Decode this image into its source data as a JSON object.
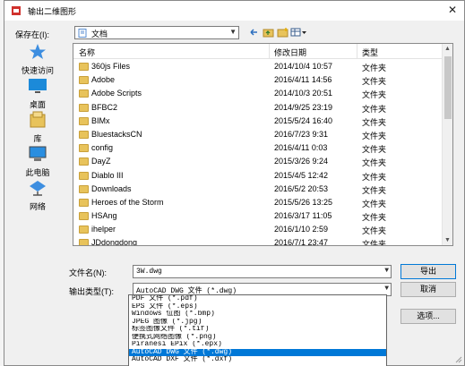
{
  "dialog": {
    "title": "输出二维图形",
    "close_glyph": "✕"
  },
  "location": {
    "label": "保存在(I):",
    "current_folder": "文档"
  },
  "toolbar": {
    "back": "back-arrow",
    "up": "up-folder",
    "new_folder": "new-folder",
    "views": "view-menu"
  },
  "places": [
    {
      "label": "快速访问",
      "icon": "star-icon"
    },
    {
      "label": "桌面",
      "icon": "desktop-icon"
    },
    {
      "label": "库",
      "icon": "library-icon"
    },
    {
      "label": "此电脑",
      "icon": "computer-icon"
    },
    {
      "label": "网络",
      "icon": "network-icon"
    }
  ],
  "file_list": {
    "columns": [
      "名称",
      "修改日期",
      "类型"
    ],
    "rows": [
      {
        "name": "360js Files",
        "date": "2014/10/4 10:57",
        "type": "文件夹"
      },
      {
        "name": "Adobe",
        "date": "2016/4/11 14:56",
        "type": "文件夹"
      },
      {
        "name": "Adobe Scripts",
        "date": "2014/10/3 20:51",
        "type": "文件夹"
      },
      {
        "name": "BFBC2",
        "date": "2014/9/25 23:19",
        "type": "文件夹"
      },
      {
        "name": "BIMx",
        "date": "2015/5/24 16:40",
        "type": "文件夹"
      },
      {
        "name": "BluestacksCN",
        "date": "2016/7/23 9:31",
        "type": "文件夹"
      },
      {
        "name": "config",
        "date": "2016/4/11 0:03",
        "type": "文件夹"
      },
      {
        "name": "DayZ",
        "date": "2015/3/26 9:24",
        "type": "文件夹"
      },
      {
        "name": "Diablo III",
        "date": "2015/4/5 12:42",
        "type": "文件夹"
      },
      {
        "name": "Downloads",
        "date": "2016/5/2 20:53",
        "type": "文件夹"
      },
      {
        "name": "Heroes of the Storm",
        "date": "2015/5/26 13:25",
        "type": "文件夹"
      },
      {
        "name": "HSAng",
        "date": "2016/3/17 11:05",
        "type": "文件夹"
      },
      {
        "name": "ihelper",
        "date": "2016/1/10 2:59",
        "type": "文件夹"
      },
      {
        "name": "JDdongdong",
        "date": "2016/7/1 23:47",
        "type": "文件夹"
      }
    ]
  },
  "filename": {
    "label": "文件名(N):",
    "value": "3W.dwg"
  },
  "filetype": {
    "label": "输出类型(T):",
    "value": "AutoCAD DWG 文件 (*.dwg)",
    "options": [
      "PDF 文件 (*.pdf)",
      "EPS 文件 (*.eps)",
      "Windows 位图 (*.bmp)",
      "JPEG 图像 (*.jpg)",
      "标签图像文件 (*.tif)",
      "便携式网络图像 (*.png)",
      "Piranesi EPix (*.epx)",
      "AutoCAD DWG 文件 (*.dwg)",
      "AutoCAD DXF 文件 (*.dxf)"
    ],
    "selected_index": 7
  },
  "buttons": {
    "export": "导出",
    "cancel": "取消",
    "options": "选项..."
  },
  "colors": {
    "selection": "#0078d7",
    "folder": "#e8c35b"
  }
}
